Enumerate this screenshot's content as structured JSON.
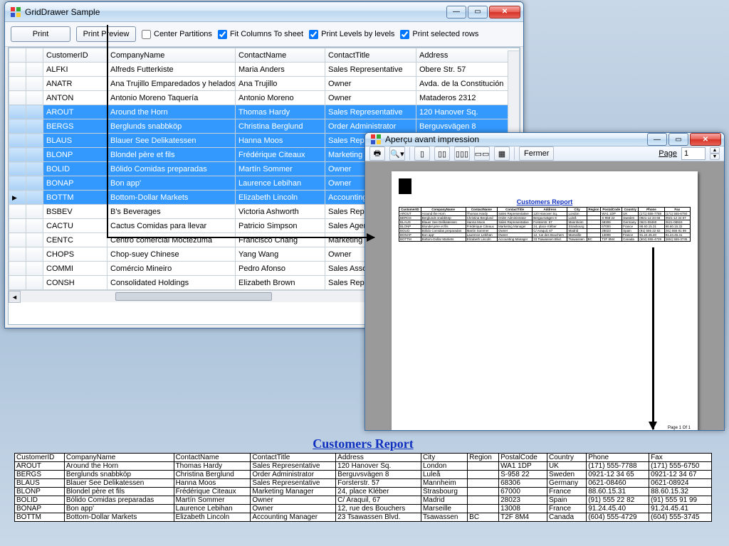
{
  "mainWindow": {
    "title": "GridDrawer Sample",
    "buttons": {
      "print": "Print",
      "preview": "Print Preview"
    },
    "checks": {
      "center": {
        "label": "Center Partitions",
        "checked": false
      },
      "fit": {
        "label": "Fit Columns To sheet",
        "checked": true
      },
      "levels": {
        "label": "Print Levels by levels",
        "checked": true
      },
      "selrows": {
        "label": "Print selected rows",
        "checked": true
      }
    },
    "columns": [
      "CustomerID",
      "CompanyName",
      "ContactName",
      "ContactTitle",
      "Address"
    ],
    "rows": [
      {
        "sel": false,
        "id": "ALFKI",
        "co": "Alfreds Futterkiste",
        "cn": "Maria Anders",
        "ct": "Sales Representative",
        "ad": "Obere Str. 57"
      },
      {
        "sel": false,
        "id": "ANATR",
        "co": "Ana Trujillo Emparedados y helados",
        "cn": "Ana Trujillo",
        "ct": "Owner",
        "ad": "Avda. de la Constitución"
      },
      {
        "sel": false,
        "id": "ANTON",
        "co": "Antonio Moreno Taquería",
        "cn": "Antonio Moreno",
        "ct": "Owner",
        "ad": "Mataderos  2312"
      },
      {
        "sel": true,
        "id": "AROUT",
        "co": "Around the Horn",
        "cn": "Thomas Hardy",
        "ct": "Sales Representative",
        "ad": "120 Hanover Sq."
      },
      {
        "sel": true,
        "id": "BERGS",
        "co": "Berglunds snabbköp",
        "cn": "Christina Berglund",
        "ct": "Order Administrator",
        "ad": "Berguvsvägen  8"
      },
      {
        "sel": true,
        "id": "BLAUS",
        "co": "Blauer See Delikatessen",
        "cn": "Hanna Moos",
        "ct": "Sales Repre"
      },
      {
        "sel": true,
        "id": "BLONP",
        "co": "Blondel père et fils",
        "cn": "Frédérique Citeaux",
        "ct": "Marketing M"
      },
      {
        "sel": true,
        "id": "BOLID",
        "co": "Bólido Comidas preparadas",
        "cn": "Martín Sommer",
        "ct": "Owner"
      },
      {
        "sel": true,
        "id": "BONAP",
        "co": "Bon app'",
        "cn": "Laurence Lebihan",
        "ct": "Owner"
      },
      {
        "sel": true,
        "current": true,
        "id": "BOTTM",
        "co": "Bottom-Dollar Markets",
        "cn": "Elizabeth Lincoln",
        "ct": "Accounting"
      },
      {
        "sel": false,
        "id": "BSBEV",
        "co": "B's Beverages",
        "cn": "Victoria Ashworth",
        "ct": "Sales Repre"
      },
      {
        "sel": false,
        "id": "CACTU",
        "co": "Cactus Comidas para llevar",
        "cn": "Patricio Simpson",
        "ct": "Sales Agent"
      },
      {
        "sel": false,
        "id": "CENTC",
        "co": "Centro comercial Moctezuma",
        "cn": "Francisco Chang",
        "ct": "Marketing M"
      },
      {
        "sel": false,
        "id": "CHOPS",
        "co": "Chop-suey Chinese",
        "cn": "Yang Wang",
        "ct": "Owner"
      },
      {
        "sel": false,
        "id": "COMMI",
        "co": "Comércio Mineiro",
        "cn": "Pedro Afonso",
        "ct": "Sales Assoc"
      },
      {
        "sel": false,
        "id": "CONSH",
        "co": "Consolidated Holdings",
        "cn": "Elizabeth Brown",
        "ct": "Sales Repre"
      }
    ]
  },
  "previewWindow": {
    "title": "Aperçu avant impression",
    "close": "Fermer",
    "pageLabel": "Page",
    "pageValue": "1",
    "footer": "Page 1 Of 1"
  },
  "report": {
    "title": "Customers Report",
    "columns": [
      "CustomerID",
      "CompanyName",
      "ContactName",
      "ContactTitle",
      "Address",
      "City",
      "Region",
      "PostalCode",
      "Country",
      "Phone",
      "Fax"
    ],
    "rows": [
      {
        "CustomerID": "AROUT",
        "CompanyName": "Around the Horn",
        "ContactName": "Thomas Hardy",
        "ContactTitle": "Sales Representative",
        "Address": "120 Hanover Sq.",
        "City": "London",
        "Region": "",
        "PostalCode": "WA1 1DP",
        "Country": "UK",
        "Phone": "(171) 555-7788",
        "Fax": "(171) 555-6750"
      },
      {
        "CustomerID": "BERGS",
        "CompanyName": "Berglunds snabbköp",
        "ContactName": "Christina Berglund",
        "ContactTitle": "Order Administrator",
        "Address": "Berguvsvägen  8",
        "City": "Luleå",
        "Region": "",
        "PostalCode": "S-958 22",
        "Country": "Sweden",
        "Phone": "0921-12 34 65",
        "Fax": "0921-12 34 67"
      },
      {
        "CustomerID": "BLAUS",
        "CompanyName": "Blauer See Delikatessen",
        "ContactName": "Hanna Moos",
        "ContactTitle": "Sales Representative",
        "Address": "Forsterstr. 57",
        "City": "Mannheim",
        "Region": "",
        "PostalCode": "68306",
        "Country": "Germany",
        "Phone": "0621-08460",
        "Fax": "0621-08924"
      },
      {
        "CustomerID": "BLONP",
        "CompanyName": "Blondel père et fils",
        "ContactName": "Frédérique Citeaux",
        "ContactTitle": "Marketing Manager",
        "Address": "24, place Kléber",
        "City": "Strasbourg",
        "Region": "",
        "PostalCode": "67000",
        "Country": "France",
        "Phone": "88.60.15.31",
        "Fax": "88.60.15.32"
      },
      {
        "CustomerID": "BOLID",
        "CompanyName": "Bólido Comidas preparadas",
        "ContactName": "Martín Sommer",
        "ContactTitle": "Owner",
        "Address": "C/ Araquil, 67",
        "City": "Madrid",
        "Region": "",
        "PostalCode": "28023",
        "Country": "Spain",
        "Phone": "(91) 555 22 82",
        "Fax": "(91) 555 91 99"
      },
      {
        "CustomerID": "BONAP",
        "CompanyName": "Bon app'",
        "ContactName": "Laurence Lebihan",
        "ContactTitle": "Owner",
        "Address": "12, rue des Bouchers",
        "City": "Marseille",
        "Region": "",
        "PostalCode": "13008",
        "Country": "France",
        "Phone": "91.24.45.40",
        "Fax": "91.24.45.41"
      },
      {
        "CustomerID": "BOTTM",
        "CompanyName": "Bottom-Dollar Markets",
        "ContactName": "Elizabeth Lincoln",
        "ContactTitle": "Accounting Manager",
        "Address": "23 Tsawassen Blvd.",
        "City": "Tsawassen",
        "Region": "BC",
        "PostalCode": "T2F 8M4",
        "Country": "Canada",
        "Phone": "(604) 555-4729",
        "Fax": "(604) 555-3745"
      }
    ]
  }
}
